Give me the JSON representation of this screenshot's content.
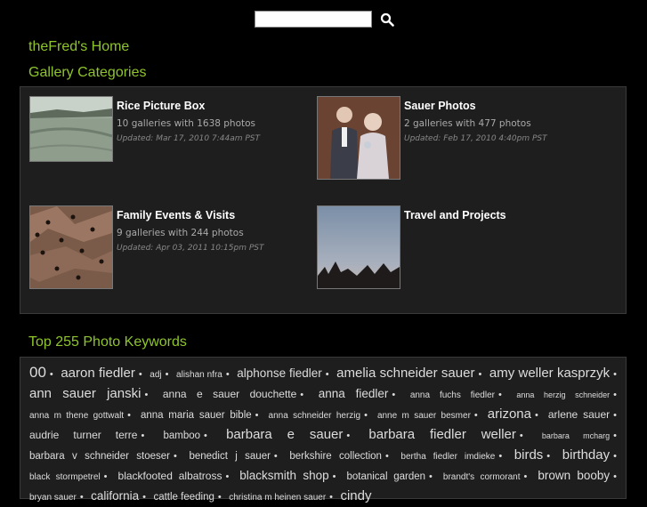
{
  "search": {
    "value": "",
    "placeholder": ""
  },
  "header": {
    "home_title": "theFred's Home",
    "categories_title": "Gallery Categories"
  },
  "categories": [
    {
      "name": "Rice Picture Box",
      "count": "10 galleries with 1638 photos",
      "updated": "Updated: Mar 17, 2010 7:44am PST",
      "thumb": "field"
    },
    {
      "name": "Sauer Photos",
      "count": "2 galleries with 477 photos",
      "updated": "Updated: Feb 17, 2010 4:40pm PST",
      "thumb": "couple"
    },
    {
      "name": "Family Events & Visits",
      "count": "9 galleries with 244 photos",
      "updated": "Updated: Apr 03, 2011 10:15pm PST",
      "thumb": "bark"
    },
    {
      "name": "Travel and Projects",
      "count": "",
      "updated": "",
      "thumb": "sky"
    }
  ],
  "keywords": {
    "title": "Top 255 Photo Keywords",
    "items": [
      {
        "t": "00",
        "s": 17
      },
      {
        "t": "aaron fiedler",
        "s": 15
      },
      {
        "t": "adj",
        "s": 10
      },
      {
        "t": "alishan nfra",
        "s": 10
      },
      {
        "t": "alphonse fiedler",
        "s": 13.5
      },
      {
        "t": "amelia schneider sauer",
        "s": 15
      },
      {
        "t": "amy weller kasprzyk",
        "s": 15
      },
      {
        "t": "ann sauer janski",
        "s": 15
      },
      {
        "t": "anna e sauer douchette",
        "s": 12
      },
      {
        "t": "anna fiedler",
        "s": 13.5
      },
      {
        "t": "anna fuchs fiedler",
        "s": 10
      },
      {
        "t": "anna herzig schneider",
        "s": 9
      },
      {
        "t": "anna m thene gottwalt",
        "s": 10
      },
      {
        "t": "anna maria sauer bible",
        "s": 11.5
      },
      {
        "t": "anna schneider herzig",
        "s": 10
      },
      {
        "t": "anne m sauer besmer",
        "s": 10
      },
      {
        "t": "arizona",
        "s": 15
      },
      {
        "t": "arlene sauer",
        "s": 12
      },
      {
        "t": "audrie turner terre",
        "s": 12
      },
      {
        "t": "bamboo",
        "s": 11.5
      },
      {
        "t": "barbara e sauer",
        "s": 15
      },
      {
        "t": "barbara fiedler weller",
        "s": 15
      },
      {
        "t": "barbara mcharg",
        "s": 9
      },
      {
        "t": "barbara v schneider stoeser",
        "s": 11.5
      },
      {
        "t": "benedict j sauer",
        "s": 11.5
      },
      {
        "t": "berkshire collection",
        "s": 11.5
      },
      {
        "t": "bertha fiedler imdieke",
        "s": 10
      },
      {
        "t": "birds",
        "s": 15
      },
      {
        "t": "birthday",
        "s": 15
      },
      {
        "t": "black stormpetrel",
        "s": 10
      },
      {
        "t": "blackfooted albatross",
        "s": 12
      },
      {
        "t": "blacksmith shop",
        "s": 13.5
      },
      {
        "t": "botanical garden",
        "s": 11.5
      },
      {
        "t": "brandt's cormorant",
        "s": 10
      },
      {
        "t": "brown booby",
        "s": 13.5
      },
      {
        "t": "bryan sauer",
        "s": 10
      },
      {
        "t": "california",
        "s": 13.5
      },
      {
        "t": "cattle feeding",
        "s": 11.5
      },
      {
        "t": "christina m heinen sauer",
        "s": 10
      },
      {
        "t": "cindy",
        "s": 15
      }
    ]
  }
}
